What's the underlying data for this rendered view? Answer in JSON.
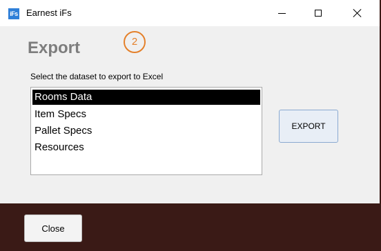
{
  "window": {
    "title": "Earnest iFs",
    "icon_text": "iFs",
    "icon_name": "app-icon",
    "controls": [
      "minimize-icon",
      "maximize-icon",
      "close-icon"
    ]
  },
  "page": {
    "title": "Export",
    "step_badge": "2",
    "instruction": "Select the dataset to export to Excel"
  },
  "datasets": {
    "items": [
      "Rooms Data",
      "Item Specs",
      "Pallet Specs",
      "Resources"
    ],
    "selected": "Rooms Data"
  },
  "actions": {
    "export_label": "EXPORT",
    "close_label": "Close"
  },
  "colors": {
    "footer": "#3a1a16",
    "badge": "#e4802a",
    "title_gray": "#7d7d7d",
    "selection": "#000000"
  }
}
